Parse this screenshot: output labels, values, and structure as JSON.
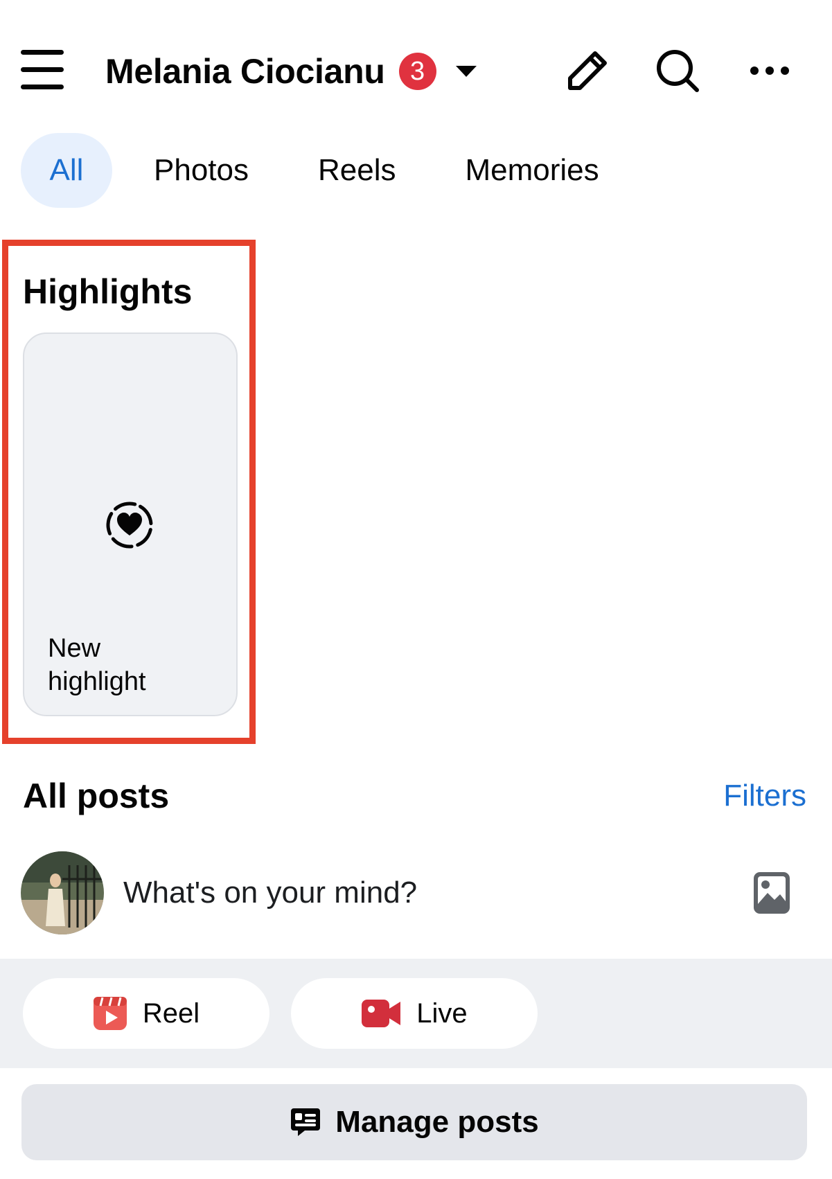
{
  "header": {
    "profile_name": "Melania Ciocianu",
    "notification_count": "3",
    "icons": [
      "menu-icon",
      "caret-down-icon",
      "pencil-icon",
      "search-icon",
      "more-dots-icon"
    ]
  },
  "tabs": [
    {
      "label": "All",
      "active": true
    },
    {
      "label": "Photos",
      "active": false
    },
    {
      "label": "Reels",
      "active": false
    },
    {
      "label": "Memories",
      "active": false
    }
  ],
  "highlights": {
    "title": "Highlights",
    "new_card_label": "New highlight",
    "new_card_icon": "heart-circle-icon"
  },
  "posts": {
    "title": "All posts",
    "filters_label": "Filters",
    "composer_prompt": "What's on your mind?",
    "actions": [
      {
        "label": "Reel",
        "icon": "reel-icon"
      },
      {
        "label": "Live",
        "icon": "live-video-icon"
      }
    ],
    "manage_label": "Manage posts"
  },
  "colors": {
    "accent": "#1b6fd1",
    "active_tab_bg": "#e7f0fd",
    "badge": "#e0323f",
    "annotation_frame": "#e5412c",
    "reel_icon": "#ec5a55",
    "live_icon": "#d22f3c"
  }
}
